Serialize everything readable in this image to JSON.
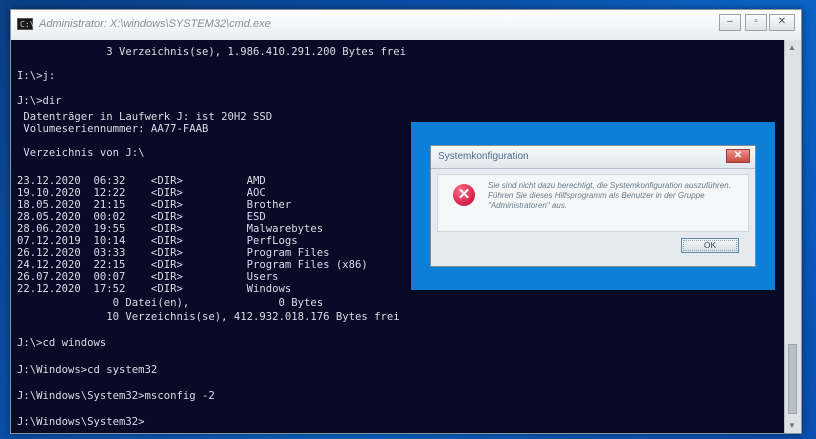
{
  "cmd_window": {
    "title": "Administrator: X:\\windows\\SYSTEM32\\cmd.exe",
    "icon_text": "C:\\",
    "controls": {
      "minimize": "–",
      "maximize": "▫",
      "close": "✕"
    },
    "lines": [
      "              3 Verzeichnis(se), 1.986.410.291.200 Bytes frei",
      "",
      "I:\\>j:",
      "",
      "J:\\>dir",
      " Datenträger in Laufwerk J: ist 20H2 SSD",
      " Volumeseriennummer: AA77-FAAB",
      "",
      " Verzeichnis von J:\\",
      "",
      "23.12.2020  06:32    <DIR>          AMD",
      "19.10.2020  12:22    <DIR>          AOC",
      "18.05.2020  21:15    <DIR>          Brother",
      "28.05.2020  00:02    <DIR>          ESD",
      "28.06.2020  19:55    <DIR>          Malwarebytes",
      "07.12.2019  10:14    <DIR>          PerfLogs",
      "26.12.2020  03:33    <DIR>          Program Files",
      "24.12.2020  22:15    <DIR>          Program Files (x86)",
      "26.07.2020  00:07    <DIR>          Users",
      "22.12.2020  17:52    <DIR>          Windows",
      "               0 Datei(en),              0 Bytes",
      "              10 Verzeichnis(se), 412.932.018.176 Bytes frei",
      "",
      "J:\\>cd windows",
      "",
      "J:\\Windows>cd system32",
      "",
      "J:\\Windows\\System32>msconfig -2",
      "",
      "J:\\Windows\\System32>"
    ]
  },
  "dialog": {
    "title": "Systemkonfiguration",
    "close_label": "✕",
    "icon": "error-x-icon",
    "message": "Sie sind nicht dazu berechtigt, die Systemkonfiguration auszuführen. Führen Sie dieses Hilfsprogramm als Benutzer in der Gruppe \"Administratoren\" aus.",
    "ok_label": "OK"
  },
  "colors": {
    "console_background": "#070b26",
    "console_text": "#d8dde6",
    "desktop_blue": "#0a4fa8",
    "dialog_frame_blue": "#0e7fd6",
    "error_red": "#d41f48"
  }
}
